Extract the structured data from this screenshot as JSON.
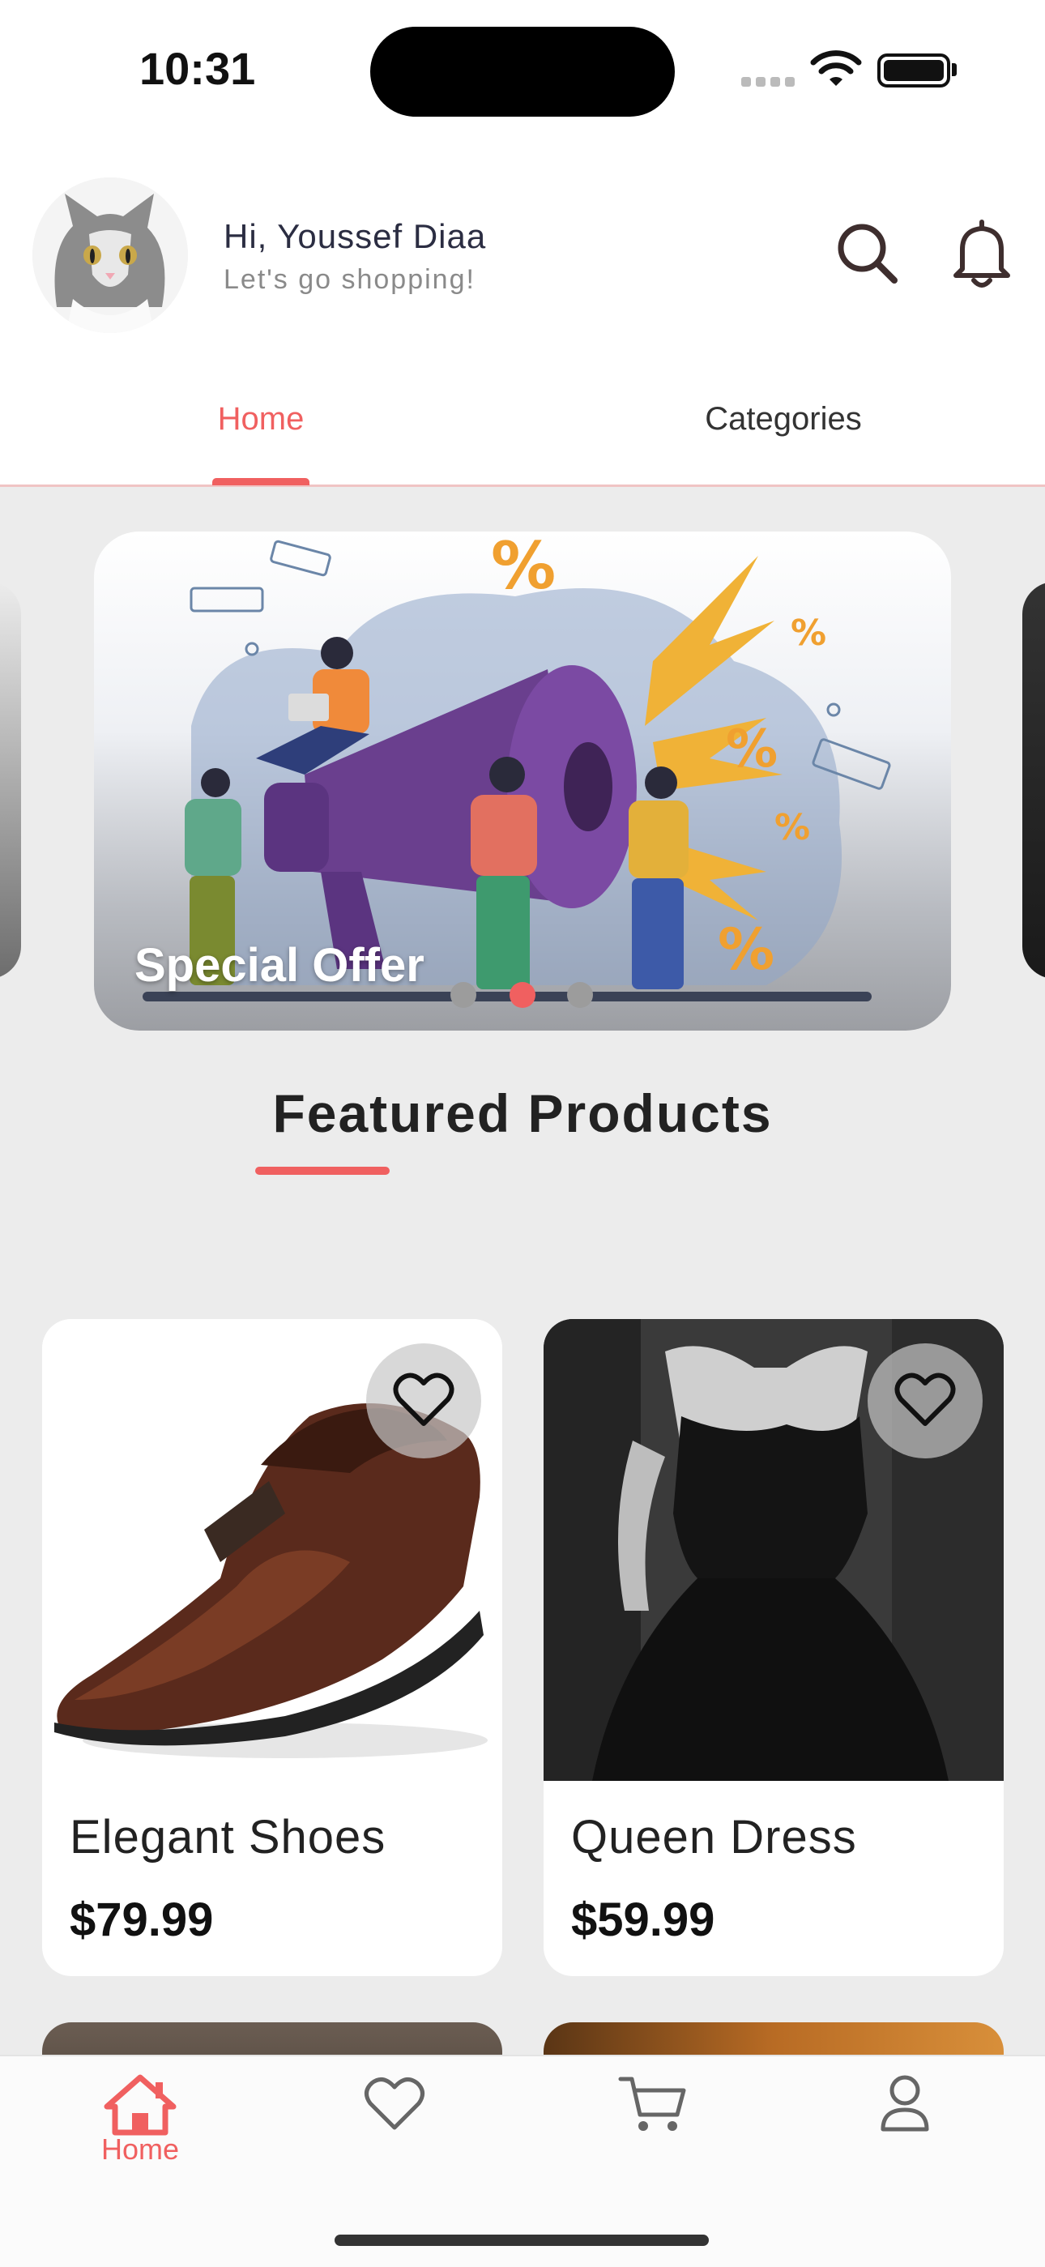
{
  "status_bar": {
    "time": "10:31"
  },
  "header": {
    "greeting": "Hi, Youssef Diaa",
    "subtitle": "Let's go shopping!"
  },
  "tabs": [
    {
      "label": "Home",
      "active": true
    },
    {
      "label": "Categories",
      "active": false
    }
  ],
  "banner": {
    "title": "Special Offer",
    "dots": 3,
    "active_dot": 2
  },
  "featured": {
    "title": "Featured Products"
  },
  "products": [
    {
      "name": "Elegant Shoes",
      "price": "$79.99"
    },
    {
      "name": "Queen Dress",
      "price": "$59.99"
    }
  ],
  "bottom_nav": {
    "items": [
      {
        "icon": "home-icon",
        "label": "Home",
        "active": true
      },
      {
        "icon": "heart-icon",
        "label": "",
        "active": false
      },
      {
        "icon": "cart-icon",
        "label": "",
        "active": false
      },
      {
        "icon": "user-icon",
        "label": "",
        "active": false
      }
    ]
  },
  "colors": {
    "accent": "#f06060",
    "background": "#ececec",
    "text": "#222222"
  }
}
